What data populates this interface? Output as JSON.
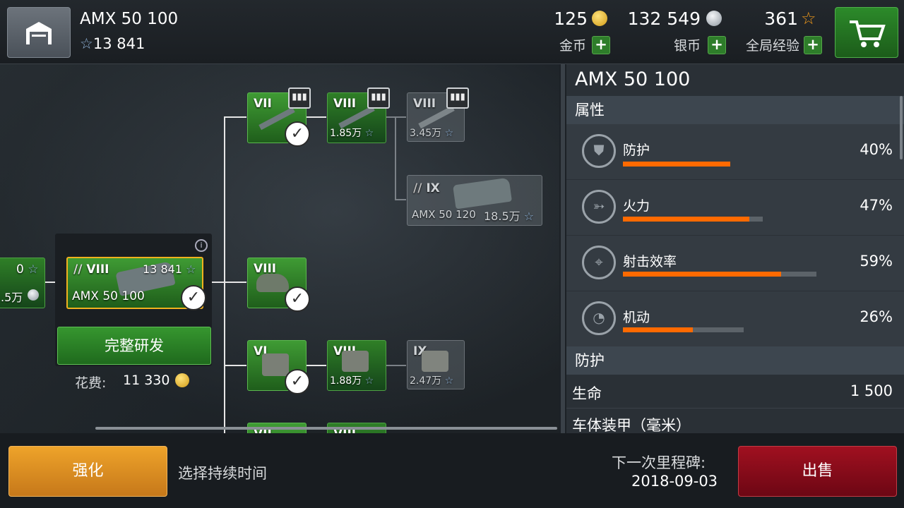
{
  "header": {
    "tank_name": "AMX 50 100",
    "tank_xp": "13 841",
    "gold_value": "125",
    "gold_label": "金币",
    "silver_value": "132 549",
    "silver_label": "银币",
    "free_xp_value": "361",
    "free_xp_label": "全局经验",
    "plus": "+"
  },
  "tree": {
    "left_node": {
      "xp": "0",
      "cost": ".5万"
    },
    "selected": {
      "tier": "VIII",
      "xp": "13 841",
      "name": "AMX 50 100",
      "research_label": "完整研发",
      "cost_label": "花费:",
      "cost_value": "11 330"
    },
    "gun_vii": {
      "tier": "VII"
    },
    "gun_viii": {
      "tier": "VIII",
      "cost": "1.85万"
    },
    "gun_viii_b": {
      "tier": "VIII",
      "cost": "3.45万"
    },
    "next_tank": {
      "tier": "IX",
      "name": "AMX 50 120",
      "cost": "18.5万"
    },
    "turret_viii": {
      "tier": "VIII"
    },
    "engine_vi": {
      "tier": "VI"
    },
    "engine_viii": {
      "tier": "VIII",
      "cost": "1.88万"
    },
    "engine_ix": {
      "tier": "IX",
      "cost": "2.47万"
    },
    "row4_a": {
      "tier": "VII"
    },
    "row4_b": {
      "tier": "VIII"
    }
  },
  "panel": {
    "title": "AMX 50 100",
    "attributes_header": "属性",
    "stats": [
      {
        "name": "防护",
        "pct": "40%",
        "value": 0.4,
        "max": 0.4
      },
      {
        "name": "火力",
        "pct": "47%",
        "value": 0.47,
        "max": 0.52
      },
      {
        "name": "射击效率",
        "pct": "59%",
        "value": 0.59,
        "max": 0.72
      },
      {
        "name": "机动",
        "pct": "26%",
        "value": 0.26,
        "max": 0.45
      }
    ],
    "protection_header": "防护",
    "hp_label": "生命",
    "hp_value": "1 500",
    "hull_armor_label": "车体装甲（毫米）"
  },
  "footer": {
    "upgrade_label": "强化",
    "duration_label": "选择持续时间",
    "milestone_label": "下一次里程碑:",
    "milestone_date": "2018-09-03",
    "sell_label": "出售"
  },
  "colors": {
    "accent_orange": "#ff6a00",
    "research_green": "#2e8a2a",
    "sell_red": "#8a0c18",
    "upgrade_gold": "#e09425"
  }
}
